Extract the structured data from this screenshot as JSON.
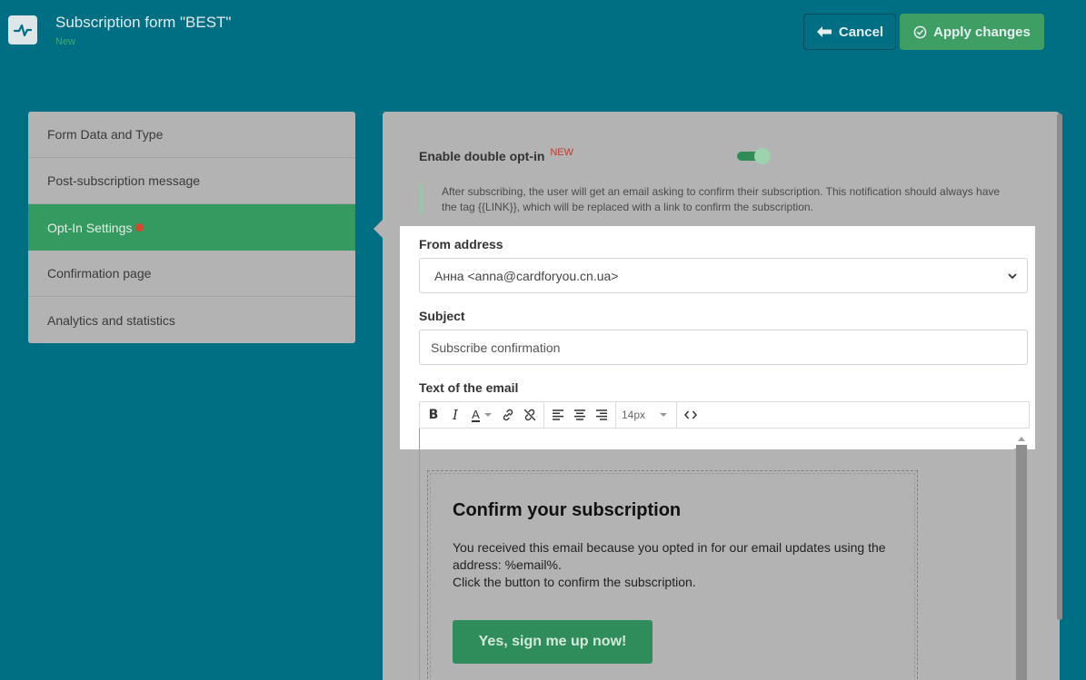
{
  "header": {
    "title": "Subscription form \"BEST\"",
    "status": "New",
    "cancel_label": "Cancel",
    "apply_label": "Apply changes"
  },
  "sidebar": {
    "items": [
      {
        "label": "Form Data and Type",
        "active": false
      },
      {
        "label": "Post-subscription message",
        "active": false
      },
      {
        "label": "Opt-In Settings",
        "active": true
      },
      {
        "label": "Confirmation page",
        "active": false
      },
      {
        "label": "Analytics and statistics",
        "active": false
      }
    ]
  },
  "optin": {
    "label": "Enable double opt-in",
    "badge": "NEW",
    "enabled": true,
    "note": "After subscribing, the user will get an email asking to confirm their subscription. This notification should always have the tag {{LINK}}, which will be replaced with a link to confirm the subscription."
  },
  "form": {
    "from_label": "From address",
    "from_value": "Анна <anna@cardforyou.cn.ua>",
    "subject_label": "Subject",
    "subject_value": "Subscribe confirmation",
    "text_label": "Text of the email",
    "font_size": "14px"
  },
  "email": {
    "title": "Confirm your subscription",
    "line1": "You received this email because you opted in for our email updates using the address: %email%.",
    "line2": "Click the button to confirm the subscription.",
    "cta": "Yes, sign me up now!"
  },
  "colors": {
    "background": "#006e83",
    "accent_green": "#3e9e63",
    "badge_red": "#c0392b"
  }
}
